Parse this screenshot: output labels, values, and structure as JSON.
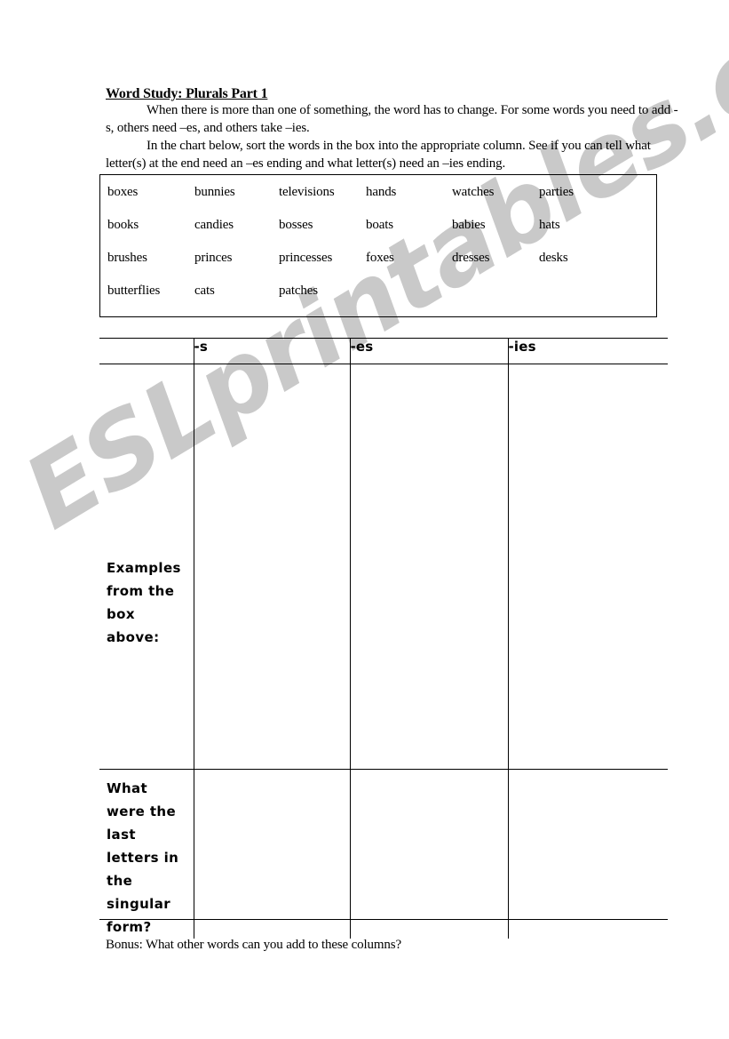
{
  "document": {
    "title": "Word Study: Plurals Part 1",
    "intro_paragraphs": [
      "When there is more than one of something, the word has to change. For some words you need to add -s, others need –es, and others take –ies.",
      "In the chart below, sort the words in the box into the appropriate column. See if you can tell what letter(s) at the end need an –es ending and what letter(s) need an –ies ending."
    ],
    "bonus": "Bonus: What other words can you add to these columns?"
  },
  "word_bank": {
    "rows": [
      [
        "boxes",
        "bunnies",
        "televisions",
        "hands",
        "watches",
        "parties"
      ],
      [
        "books",
        "candies",
        "bosses",
        "boats",
        "babies",
        "hats"
      ],
      [
        "brushes",
        "princes",
        "princesses",
        "foxes",
        "dresses",
        "desks"
      ],
      [
        "butterflies",
        "cats",
        "patches",
        "",
        "",
        ""
      ]
    ]
  },
  "sorting_chart": {
    "headers": {
      "corner": "",
      "col_s": "-s",
      "col_es": "-es",
      "col_ies": "-ies"
    },
    "row_labels": {
      "examples": "Examples from the box above:",
      "singular": "What were the last letters in the singular form?"
    },
    "cells": {
      "examples_s": "",
      "examples_es": "",
      "examples_ies": "",
      "singular_s": "",
      "singular_es": "",
      "singular_ies": ""
    }
  },
  "watermark": {
    "text": "ESLprintables.com",
    "color": "#c9c9c9"
  }
}
